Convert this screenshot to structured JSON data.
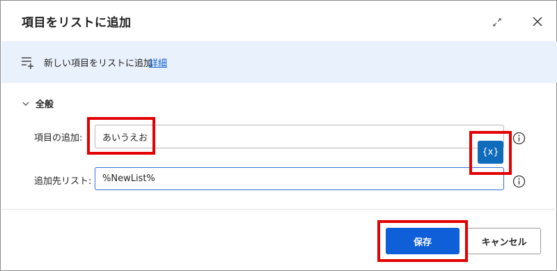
{
  "dialog": {
    "title": "項目をリストに追加"
  },
  "info_bar": {
    "text": "新しい項目をリストに追加",
    "link": "詳細"
  },
  "section": {
    "title": "全般"
  },
  "fields": {
    "add_item": {
      "label": "項目の追加:",
      "value": "あいうえお"
    },
    "target_list": {
      "label": "追加先リスト:",
      "value": "%NewList%"
    }
  },
  "variable_button": {
    "label": "{x}"
  },
  "footer": {
    "save_label": "保存",
    "cancel_label": "キャンセル"
  },
  "colors": {
    "accent": "#0f5fd8",
    "info_bg": "#e9f1fc",
    "highlight": "#e30000"
  },
  "icons": [
    "expand-icon",
    "close-icon",
    "add-list-item-icon",
    "chevron-down-icon",
    "info-icon"
  ]
}
